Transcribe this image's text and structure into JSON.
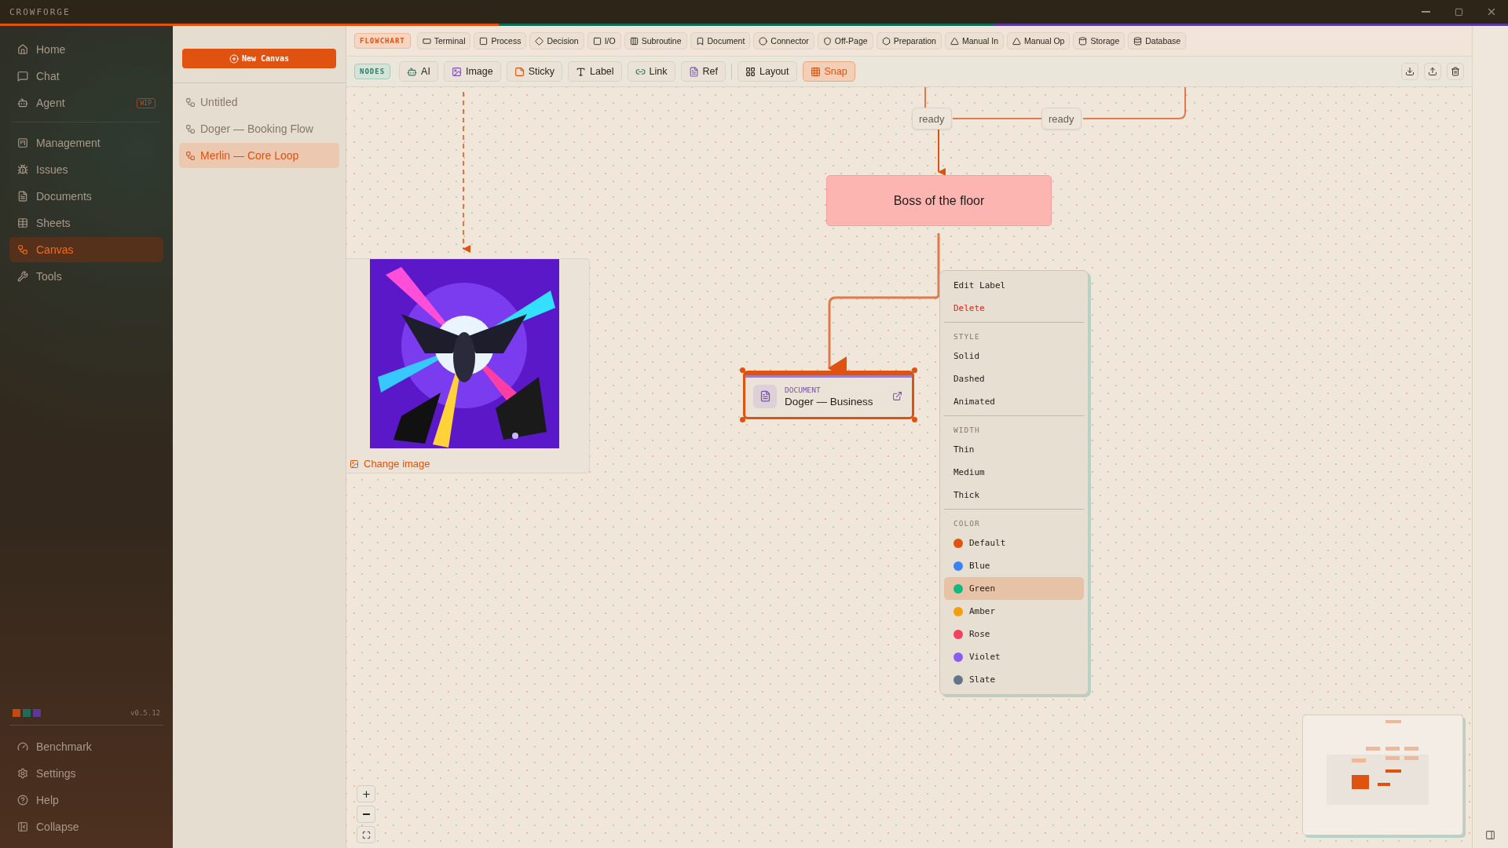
{
  "window": {
    "title": "CROWFORGE"
  },
  "sidebar": {
    "items": [
      {
        "label": "Home",
        "selected": false
      },
      {
        "label": "Chat",
        "selected": false
      },
      {
        "label": "Agent",
        "selected": false,
        "badge": "WIP"
      },
      {
        "label": "Management",
        "selected": false,
        "group_start": true
      },
      {
        "label": "Issues",
        "selected": false
      },
      {
        "label": "Documents",
        "selected": false
      },
      {
        "label": "Sheets",
        "selected": false
      },
      {
        "label": "Canvas",
        "selected": true
      },
      {
        "label": "Tools",
        "selected": false
      }
    ],
    "version": "v0.5.12",
    "bottom_items": [
      {
        "label": "Benchmark"
      },
      {
        "label": "Settings"
      },
      {
        "label": "Help"
      },
      {
        "label": "Collapse"
      }
    ]
  },
  "canvas_list": {
    "new_button": "New Canvas",
    "items": [
      {
        "label": "Untitled",
        "selected": false
      },
      {
        "label": "Doger — Booking Flow",
        "selected": false
      },
      {
        "label": "Merlin — Core Loop",
        "selected": true
      }
    ]
  },
  "flowchart_toolbar": {
    "label": "FLOWCHART",
    "items": [
      "Terminal",
      "Process",
      "Decision",
      "I/O",
      "Subroutine",
      "Document",
      "Connector",
      "Off-Page",
      "Preparation",
      "Manual In",
      "Manual Op",
      "Storage",
      "Database"
    ]
  },
  "nodes_toolbar": {
    "label": "NODES",
    "items": [
      {
        "label": "AI",
        "on": false
      },
      {
        "label": "Image",
        "on": false
      },
      {
        "label": "Sticky",
        "on": false
      },
      {
        "label": "Label",
        "on": false
      },
      {
        "label": "Link",
        "on": false
      },
      {
        "label": "Ref",
        "on": false
      },
      {
        "label": "Layout",
        "on": false,
        "separator_before": true
      },
      {
        "label": "Snap",
        "on": true
      }
    ]
  },
  "canvas": {
    "edge_labels": [
      "ready",
      "ready"
    ],
    "process_node": {
      "label": "Boss of the floor"
    },
    "document_node": {
      "kind_label": "DOCUMENT",
      "title": "Doger — Business",
      "selected": true
    },
    "image_node": {
      "kind": "picture",
      "action": "Change image"
    },
    "context_menu": {
      "actions": [
        {
          "label": "Edit Label",
          "kind": "normal"
        },
        {
          "label": "Delete",
          "kind": "danger"
        }
      ],
      "style": {
        "heading": "STYLE",
        "items": [
          "Solid",
          "Dashed",
          "Animated"
        ]
      },
      "width": {
        "heading": "WIDTH",
        "items": [
          "Thin",
          "Medium",
          "Thick"
        ]
      },
      "color": {
        "heading": "COLOR",
        "items": [
          {
            "label": "Default",
            "color": "#e0520f",
            "selected": false
          },
          {
            "label": "Blue",
            "color": "#3b82f6",
            "selected": false
          },
          {
            "label": "Green",
            "color": "#10b981",
            "selected": true
          },
          {
            "label": "Amber",
            "color": "#f59e0b",
            "selected": false
          },
          {
            "label": "Rose",
            "color": "#f43f5e",
            "selected": false
          },
          {
            "label": "Violet",
            "color": "#8b5cf6",
            "selected": false
          },
          {
            "label": "Slate",
            "color": "#64748b",
            "selected": false
          }
        ]
      }
    }
  }
}
